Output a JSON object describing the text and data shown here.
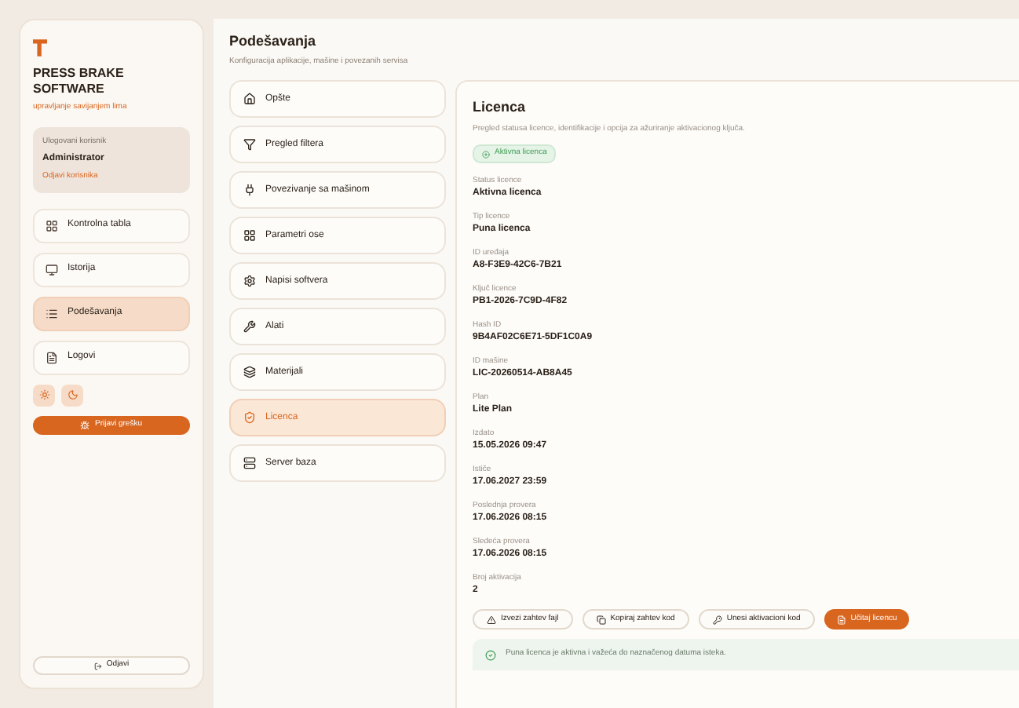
{
  "sidebar": {
    "brand": "PRESS BRAKE SOFTWARE",
    "tagline": "upravljanje savijanjem lima",
    "user": {
      "label": "Ulogovani korisnik",
      "name": "Administrator",
      "action": "Odjavi korisnika"
    },
    "items": [
      {
        "label": "Kontrolna tabla",
        "selected": false
      },
      {
        "label": "Istorija",
        "selected": false
      },
      {
        "label": "Podešavanja",
        "selected": true
      },
      {
        "label": "Logovi",
        "selected": false
      }
    ],
    "report_button": "Prijavi grešku",
    "logout_button": "Odjavi"
  },
  "header": {
    "title": "Podešavanja",
    "subtitle": "Konfiguracija aplikacije, mašine i povezanih servisa"
  },
  "settings_menu": [
    {
      "label": "Opšte",
      "selected": false
    },
    {
      "label": "Pregled filtera",
      "selected": false
    },
    {
      "label": "Povezivanje sa mašinom",
      "selected": false
    },
    {
      "label": "Parametri ose",
      "selected": false
    },
    {
      "label": "Napisi softvera",
      "selected": false
    },
    {
      "label": "Alati",
      "selected": false
    },
    {
      "label": "Materijali",
      "selected": false
    },
    {
      "label": "Licenca",
      "selected": true
    },
    {
      "label": "Server baza",
      "selected": false
    }
  ],
  "license": {
    "title": "Licenca",
    "description": "Pregled statusa licence, identifikacije i opcija za ažuriranje aktivacionog ključa.",
    "status_badge": "Aktivna licenca",
    "fields": [
      {
        "label": "Status licence",
        "value": "Aktivna licenca"
      },
      {
        "label": "Tip licence",
        "value": "Puna licenca"
      },
      {
        "label": "ID uređaja",
        "value": "A8-F3E9-42C6-7B21"
      },
      {
        "label": "Ključ licence",
        "value": "PB1-2026-7C9D-4F82"
      },
      {
        "label": "Hash ID",
        "value": "9B4AF02C6E71-5DF1C0A9"
      },
      {
        "label": "ID mašine",
        "value": "LIC-20260514-AB8A45"
      },
      {
        "label": "Plan",
        "value": "Lite Plan"
      },
      {
        "label": "Izdato",
        "value": "15.05.2026 09:47"
      },
      {
        "label": "Ističe",
        "value": "17.06.2027 23:59"
      },
      {
        "label": "Poslednja provera",
        "value": "17.06.2026 08:15"
      },
      {
        "label": "Sledeća provera",
        "value": "17.06.2026 08:15"
      },
      {
        "label": "Broj aktivacija",
        "value": "2"
      }
    ],
    "buttons": [
      {
        "label": "Izvezi zahtev fajl",
        "kind": "outline"
      },
      {
        "label": "Kopiraj zahtev kod",
        "kind": "outline"
      },
      {
        "label": "Unesi aktivacioni kod",
        "kind": "outline"
      },
      {
        "label": "Učitaj licencu",
        "kind": "primary"
      }
    ],
    "notice": "Puna licenca je aktivna i važeća do naznačenog datuma isteka."
  }
}
